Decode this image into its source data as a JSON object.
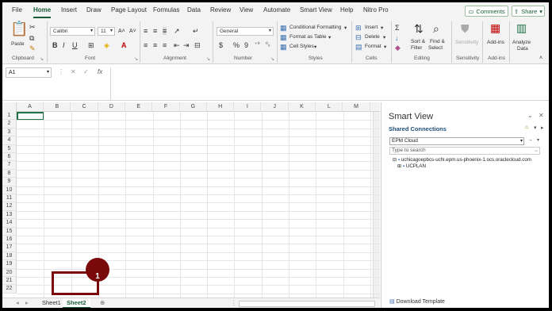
{
  "menu": {
    "tabs": [
      "File",
      "Home",
      "Insert",
      "Draw",
      "Page Layout",
      "Formulas",
      "Data",
      "Review",
      "View",
      "Automate",
      "Smart View",
      "Help",
      "Nitro Pro"
    ],
    "active": "Home",
    "comments_label": "Comments",
    "share_label": "Share"
  },
  "ribbon": {
    "clipboard": {
      "label": "Clipboard",
      "paste": "Paste"
    },
    "font": {
      "label": "Font",
      "name": "Calibri",
      "size": "11",
      "bold": "B",
      "italic": "I",
      "underline": "U"
    },
    "alignment": {
      "label": "Alignment"
    },
    "number": {
      "label": "Number",
      "format": "General",
      "currency": "$",
      "percent": "%",
      "comma": "9"
    },
    "styles": {
      "label": "Styles",
      "conditional": "Conditional Formatting",
      "as_table": "Format as Table",
      "cell_styles": "Cell Styles"
    },
    "cells": {
      "label": "Cells",
      "insert": "Insert",
      "delete": "Delete",
      "format": "Format"
    },
    "editing": {
      "label": "Editing",
      "sum": "Σ",
      "sort": "Sort &",
      "sort2": "Filter",
      "find": "Find &",
      "find2": "Select"
    },
    "sensitivity": {
      "label": "Sensitivity",
      "btn": "Sensitivity"
    },
    "addins": {
      "label": "Add-ins",
      "btn": "Add-ins"
    },
    "analyze": {
      "btn": "Analyze",
      "btn2": "Data"
    }
  },
  "formula_bar": {
    "name_box": "A1",
    "value": ""
  },
  "grid": {
    "columns": [
      "A",
      "B",
      "C",
      "D",
      "E",
      "F",
      "G",
      "H",
      "I",
      "J",
      "K",
      "L",
      "M"
    ],
    "rows": [
      "1",
      "2",
      "3",
      "4",
      "5",
      "6",
      "7",
      "8",
      "9",
      "10",
      "11",
      "12",
      "13",
      "14",
      "15",
      "16",
      "17",
      "18",
      "19",
      "20",
      "21",
      "22"
    ],
    "selected": "A1"
  },
  "sheets": [
    {
      "label": "Sheet1",
      "active": false
    },
    {
      "label": "Sheet2",
      "active": true
    }
  ],
  "smart_view": {
    "title": "Smart View",
    "subtitle": "Shared Connections",
    "connection": "EPM Cloud",
    "search_placeholder": "Type to search",
    "server": "uchicagoepbcs-uchi.epm.us-phoenix-1.ocs.oraclecloud.com",
    "app": "UCPLAN",
    "template_link": "Download Template"
  },
  "annotation": {
    "number": "1",
    "color": "#7a0a0a"
  }
}
